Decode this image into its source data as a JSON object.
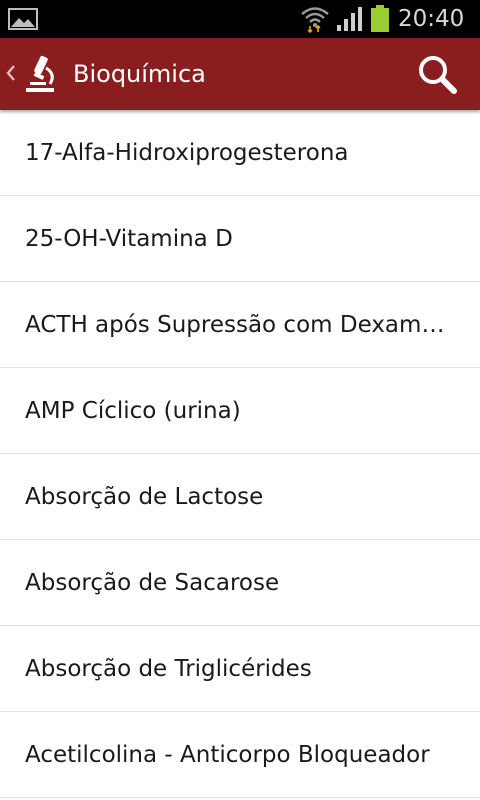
{
  "status_bar": {
    "time": "20:40",
    "icons": [
      "gallery-notification-icon",
      "wifi-icon",
      "signal-icon",
      "battery-icon"
    ]
  },
  "action_bar": {
    "title": "Bioquímica",
    "icons": [
      "back-chevron-icon",
      "microscope-icon",
      "search-icon"
    ]
  },
  "colors": {
    "action_bar": "#8a1e1f",
    "status_bar": "#000000",
    "battery": "#9acd32",
    "text": "#1a1a1a",
    "divider": "#e2e2e2"
  },
  "list": {
    "items": [
      {
        "label": "17-Alfa-Hidroxiprogesterona"
      },
      {
        "label": "25-OH-Vitamina D"
      },
      {
        "label": "ACTH após Supressão com Dexametasona"
      },
      {
        "label": "AMP Cíclico (urina)"
      },
      {
        "label": "Absorção de Lactose"
      },
      {
        "label": "Absorção de Sacarose"
      },
      {
        "label": "Absorção de Triglicérides"
      },
      {
        "label": "Acetilcolina - Anticorpo Bloqueador"
      }
    ]
  }
}
